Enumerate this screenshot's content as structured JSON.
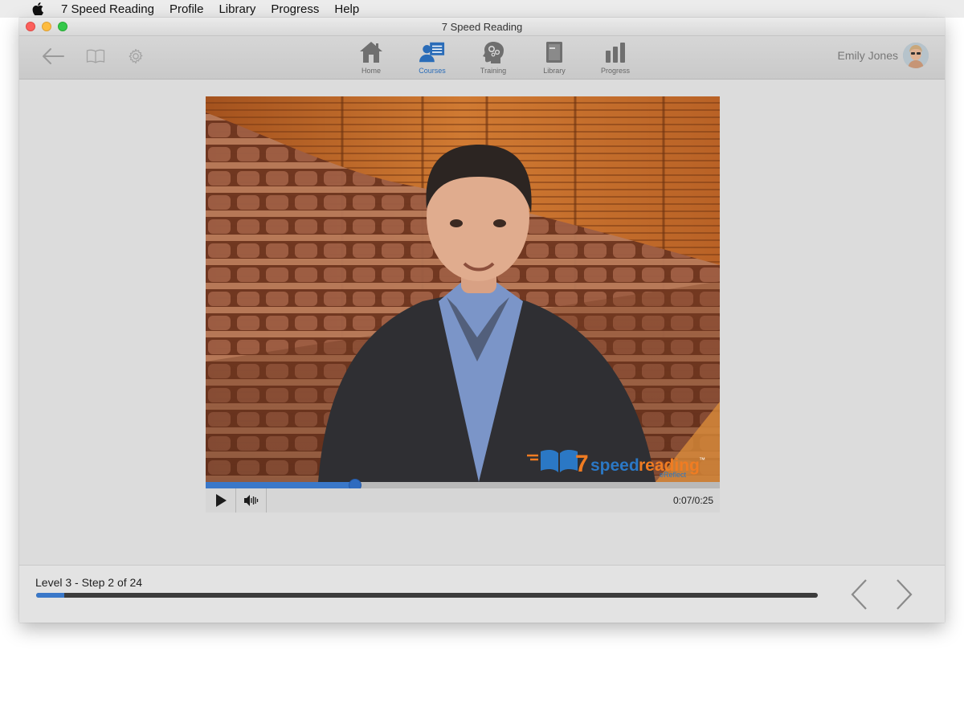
{
  "menubar": {
    "apple_icon": "apple-icon",
    "items": [
      "7 Speed Reading",
      "Profile",
      "Library",
      "Progress",
      "Help"
    ]
  },
  "window": {
    "title": "7 Speed Reading"
  },
  "toolbar": {
    "left_icons": [
      "back-arrow-icon",
      "book-icon",
      "gear-icon"
    ],
    "nav": [
      {
        "label": "Home",
        "icon": "home-icon",
        "active": false
      },
      {
        "label": "Courses",
        "icon": "courses-icon",
        "active": true
      },
      {
        "label": "Training",
        "icon": "brain-gears-icon",
        "active": false
      },
      {
        "label": "Library",
        "icon": "library-book-icon",
        "active": false
      },
      {
        "label": "Progress",
        "icon": "bar-chart-icon",
        "active": false
      }
    ],
    "user_name": "Emily Jones"
  },
  "video": {
    "logo_text_number": "7",
    "logo_text_speed": "speed",
    "logo_text_reading": "reading",
    "logo_text_tm": "™",
    "logo_text_sub": "eReflect",
    "played_fraction": 0.29,
    "current_time": "0:07",
    "duration": "0:25",
    "time_display": "0:07/0:25"
  },
  "bottom": {
    "step_label": "Level 3 - Step 2 of 24",
    "progress_fraction": 0.036,
    "prev_icon": "chevron-left-icon",
    "next_icon": "chevron-right-icon"
  },
  "colors": {
    "accent": "#3a78c9",
    "nav_active": "#2a6cb8",
    "logo_orange": "#f07c22",
    "logo_blue": "#2b78c5"
  }
}
